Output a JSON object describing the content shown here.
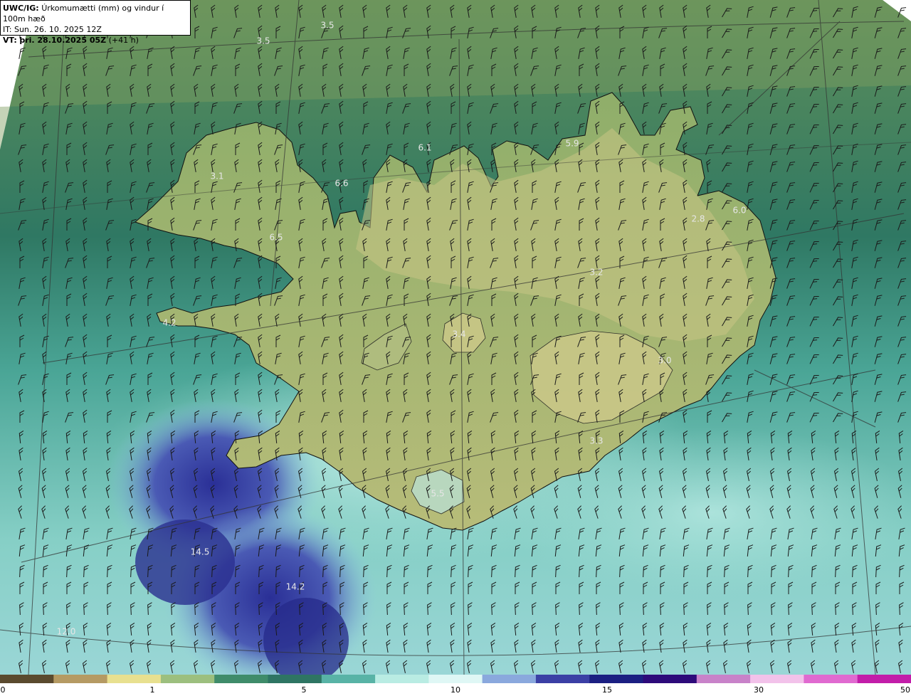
{
  "header": {
    "model": "UWC/IG:",
    "title": "Úrkomumætti (mm) og vindur í 100m hæð",
    "it_line": "IT: Sun. 26. 10. 2025 12Z",
    "vt_prefix": "VT:",
    "vt_value": "þri. 28.10.2025 05Z",
    "vt_suffix": "(+41 h)"
  },
  "values": [
    "3.5",
    "3.5",
    "3.1",
    "6.6",
    "6.1",
    "5.9",
    "6.0",
    "2.8",
    "6.5",
    "3.2",
    "4.2",
    "3.4",
    "3.0",
    "3.3",
    "5.5",
    "14.5",
    "14.2",
    "12.0"
  ],
  "colorbar": {
    "ticks": [
      "0",
      "1",
      "5",
      "10",
      "15",
      "30",
      "50"
    ],
    "colors": [
      "#5a4a2e",
      "#b59a63",
      "#e8e08f",
      "#9cbf7e",
      "#3f8c6a",
      "#2e7563",
      "#58b3a6",
      "#b9ece3",
      "#dff7f5",
      "#8aa8dd",
      "#3b3fa5",
      "#1b1f82",
      "#2d0a7a",
      "#c882c9",
      "#f2c2ea",
      "#e06ad0",
      "#c21da9"
    ]
  },
  "colors": {
    "sea_dark": "#2f6e5e",
    "land": "#b8bd77",
    "wet_sea": "#a9e4dd",
    "heavy_rain": "#3b45a6"
  }
}
